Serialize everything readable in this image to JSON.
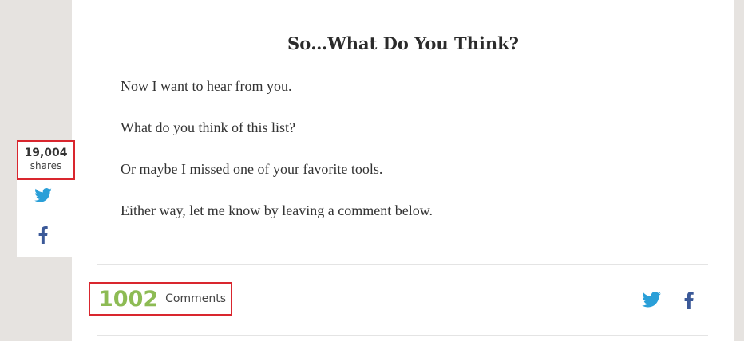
{
  "article": {
    "heading": "So…What Do You Think?",
    "paragraphs": [
      "Now I want to hear from you.",
      "What do you think of this list?",
      "Or maybe I missed one of your favorite tools.",
      "Either way, let me know by leaving a comment below."
    ]
  },
  "comments": {
    "count": "1002",
    "label": "Comments"
  },
  "share_bar": {
    "count": "19,004",
    "label": "shares"
  },
  "icons": {
    "twitter": "twitter-icon",
    "facebook": "facebook-icon"
  },
  "colors": {
    "twitter": "#2a9fd8",
    "facebook": "#3b5998",
    "highlight": "#d9262e",
    "comments_count": "#8dbb54"
  }
}
